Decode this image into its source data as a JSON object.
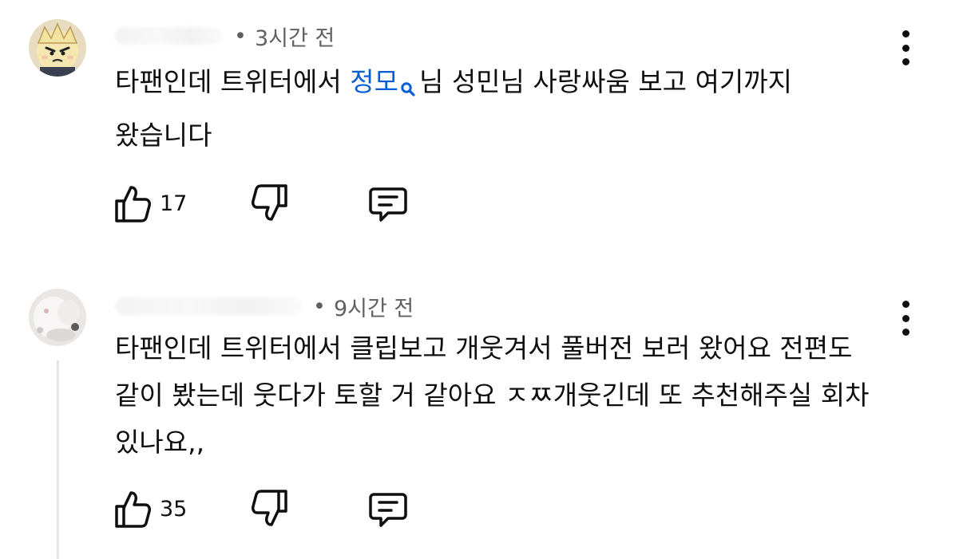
{
  "comments": [
    {
      "time": "3시간 전",
      "avatar": "angry-cartoon-avatar",
      "text_before": "타팬인데 트위터에서 ",
      "link_text": "정모",
      "link_icon": "search-icon",
      "text_after": "님 성민님 사랑싸움 보고 여기까지 왔습니다",
      "likes": "17"
    },
    {
      "time": "9시간 전",
      "avatar": "white-plush-avatar",
      "text": "타팬인데 트위터에서 클립보고 개웃겨서 풀버전 보러 왔어요 전편도 같이 봤는데 웃다가 토할 거 같아요 ㅈㅉ개웃긴데 또 추천해주실 회차 있나요,,",
      "likes": "35"
    }
  ],
  "icons": {
    "like": "thumbs-up-icon",
    "dislike": "thumbs-down-icon",
    "reply": "reply-icon",
    "more": "more-vert-icon"
  },
  "colors": {
    "text": "#0f0f0f",
    "meta": "#606060",
    "link": "#065fd4",
    "thread_line": "#e5e5e5"
  }
}
